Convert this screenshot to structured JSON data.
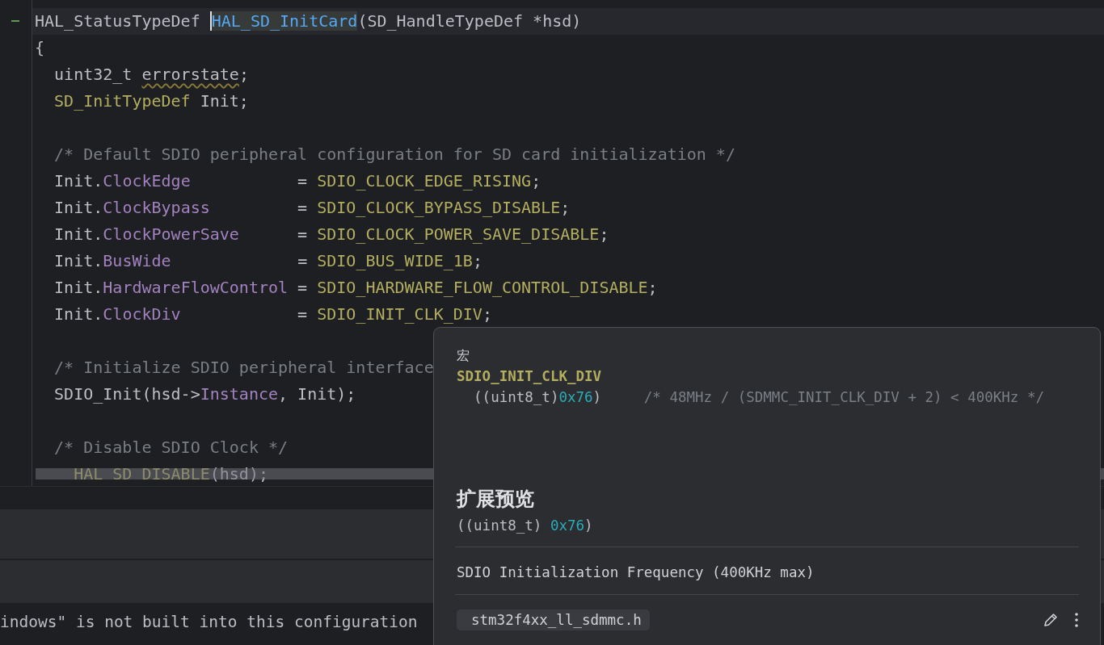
{
  "editor": {
    "lines": [
      {
        "current": true,
        "changed": true,
        "tokens": [
          {
            "kind": "text",
            "text": "HAL_StatusTypeDef "
          },
          {
            "kind": "function-at-caret",
            "text": "HAL_SD_InitCard"
          },
          {
            "kind": "text",
            "text": "(SD_HandleTypeDef *hsd)"
          }
        ]
      },
      {
        "current": false,
        "changed": false,
        "tokens": [
          {
            "kind": "text",
            "text": "{"
          }
        ]
      },
      {
        "current": false,
        "changed": false,
        "tokens": [
          {
            "kind": "text",
            "text": "  uint32_t "
          },
          {
            "kind": "warning",
            "text": "errorstate"
          },
          {
            "kind": "text",
            "text": ";"
          }
        ]
      },
      {
        "current": false,
        "changed": false,
        "tokens": [
          {
            "kind": "type",
            "text": "  SD_InitTypeDef"
          },
          {
            "kind": "text",
            "text": " Init;"
          }
        ]
      },
      {
        "current": false,
        "changed": false
      },
      {
        "current": false,
        "changed": false,
        "tokens": [
          {
            "kind": "comment",
            "text": "  /* Default SDIO peripheral configuration for SD card initialization */"
          }
        ]
      },
      {
        "current": false,
        "changed": false,
        "tokens": [
          {
            "kind": "text",
            "text": "  Init."
          },
          {
            "kind": "field",
            "text": "ClockEdge"
          },
          {
            "kind": "text",
            "text": "           = "
          },
          {
            "kind": "macro",
            "text": "SDIO_CLOCK_EDGE_RISING"
          },
          {
            "kind": "text",
            "text": ";"
          }
        ]
      },
      {
        "current": false,
        "changed": false,
        "tokens": [
          {
            "kind": "text",
            "text": "  Init."
          },
          {
            "kind": "field",
            "text": "ClockBypass"
          },
          {
            "kind": "text",
            "text": "         = "
          },
          {
            "kind": "macro",
            "text": "SDIO_CLOCK_BYPASS_DISABLE"
          },
          {
            "kind": "text",
            "text": ";"
          }
        ]
      },
      {
        "current": false,
        "changed": false,
        "tokens": [
          {
            "kind": "text",
            "text": "  Init."
          },
          {
            "kind": "field",
            "text": "ClockPowerSave"
          },
          {
            "kind": "text",
            "text": "      = "
          },
          {
            "kind": "macro",
            "text": "SDIO_CLOCK_POWER_SAVE_DISABLE"
          },
          {
            "kind": "text",
            "text": ";"
          }
        ]
      },
      {
        "current": false,
        "changed": false,
        "tokens": [
          {
            "kind": "text",
            "text": "  Init."
          },
          {
            "kind": "field",
            "text": "BusWide"
          },
          {
            "kind": "text",
            "text": "             = "
          },
          {
            "kind": "macro",
            "text": "SDIO_BUS_WIDE_1B"
          },
          {
            "kind": "text",
            "text": ";"
          }
        ]
      },
      {
        "current": false,
        "changed": false,
        "tokens": [
          {
            "kind": "text",
            "text": "  Init."
          },
          {
            "kind": "field",
            "text": "HardwareFlowControl"
          },
          {
            "kind": "text",
            "text": " = "
          },
          {
            "kind": "macro",
            "text": "SDIO_HARDWARE_FLOW_CONTROL_DISABLE"
          },
          {
            "kind": "text",
            "text": ";"
          }
        ]
      },
      {
        "current": false,
        "changed": false,
        "tokens": [
          {
            "kind": "text",
            "text": "  Init."
          },
          {
            "kind": "field",
            "text": "ClockDiv"
          },
          {
            "kind": "text",
            "text": "            = "
          },
          {
            "kind": "macro",
            "text": "SDIO_INIT_CLK_DIV"
          },
          {
            "kind": "text",
            "text": ";"
          }
        ]
      },
      {
        "current": false,
        "changed": false
      },
      {
        "current": false,
        "changed": false,
        "tokens": [
          {
            "kind": "comment",
            "text": "  /* Initialize SDIO peripheral interface"
          }
        ]
      },
      {
        "current": false,
        "changed": false,
        "tokens": [
          {
            "kind": "text",
            "text": "  SDIO_Init(hsd->"
          },
          {
            "kind": "field",
            "text": "Instance"
          },
          {
            "kind": "text",
            "text": ", Init);"
          }
        ]
      },
      {
        "current": false,
        "changed": false
      },
      {
        "current": false,
        "changed": false,
        "tokens": [
          {
            "kind": "comment",
            "text": "  /* Disable SDIO Clock */"
          }
        ]
      },
      {
        "current": false,
        "changed": false,
        "tokens": [
          {
            "kind": "macro",
            "text": "    HAL SD DISABLE"
          },
          {
            "kind": "text",
            "text": "(hsd);"
          }
        ]
      }
    ]
  },
  "console": {
    "lines": [
      "indows\" is not built into this configuration"
    ]
  },
  "popup": {
    "kind_label": "宏",
    "name": "SDIO_INIT_CLK_DIV",
    "definition": [
      {
        "kind": "text",
        "text": "  ((uint8_t)"
      },
      {
        "kind": "number",
        "text": "0x76"
      },
      {
        "kind": "text",
        "text": ")     "
      },
      {
        "kind": "comment",
        "text": "/* 48MHz / (SDMMC_INIT_CLK_DIV + 2) < 400KHz */"
      }
    ],
    "expansion_title": "扩展预览",
    "expansion": [
      {
        "kind": "text",
        "text": "((uint8_t) "
      },
      {
        "kind": "number",
        "text": "0x76"
      },
      {
        "kind": "text",
        "text": ")"
      }
    ],
    "description": "SDIO Initialization Frequency (400KHz max)",
    "file": "stm32f4xx_ll_sdmmc.h"
  }
}
